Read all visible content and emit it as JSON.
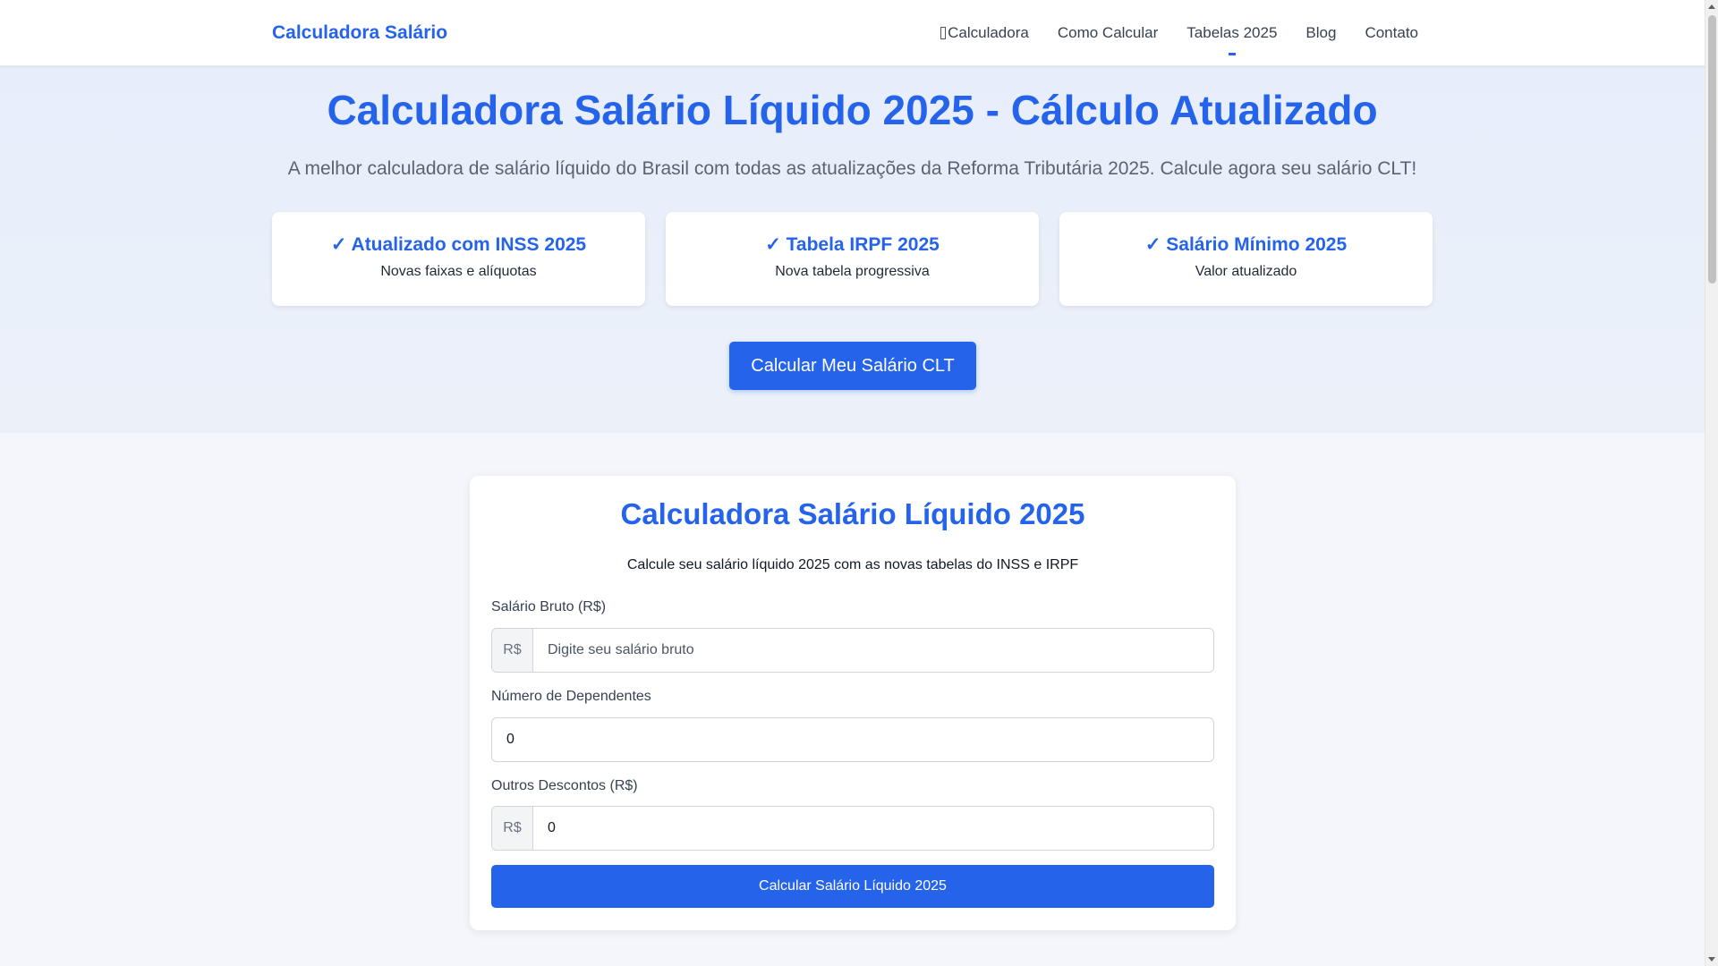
{
  "header": {
    "brand": "Calculadora Salário",
    "nav": [
      {
        "label": "Calculadora",
        "active": false
      },
      {
        "label": "Como Calcular",
        "active": false
      },
      {
        "label": "Tabelas 2025",
        "active": true
      },
      {
        "label": "Blog",
        "active": false
      },
      {
        "label": "Contato",
        "active": false
      }
    ]
  },
  "hero": {
    "title": "Calculadora Salário Líquido 2025 - Cálculo Atualizado",
    "subtitle": "A melhor calculadora de salário líquido do Brasil com todas as atualizações da Reforma Tributária 2025. Calcule agora seu salário CLT!",
    "features": [
      {
        "title": "✓ Atualizado com INSS 2025",
        "desc": "Novas faixas e alíquotas"
      },
      {
        "title": "✓ Tabela IRPF 2025",
        "desc": "Nova tabela progressiva"
      },
      {
        "title": "✓ Salário Mínimo 2025",
        "desc": "Valor atualizado"
      }
    ],
    "cta_label": "Calcular Meu Salário CLT"
  },
  "calculator": {
    "title": "Calculadora Salário Líquido 2025",
    "description": "Calcule seu salário líquido 2025 com as novas tabelas do INSS e IRPF",
    "gross_salary": {
      "label": "Salário Bruto (R$)",
      "prefix": "R$",
      "placeholder": "Digite seu salário bruto",
      "value": ""
    },
    "dependents": {
      "label": "Número de Dependentes",
      "value": "0"
    },
    "other_discounts": {
      "label": "Outros Descontos (R$)",
      "prefix": "R$",
      "value": "0"
    },
    "submit_label": "Calcular Salário Líquido 2025"
  },
  "colors": {
    "accent": "#2563eb",
    "hero_bg": "#e7eefb",
    "page_bg": "#f4f6fb"
  }
}
